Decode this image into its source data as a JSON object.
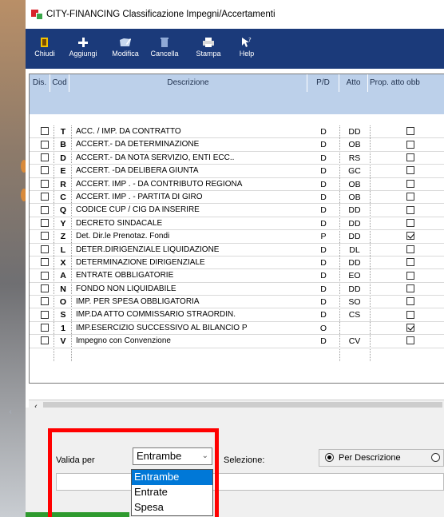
{
  "window": {
    "title": "CITY-FINANCING  Classificazione Impegni/Accertamenti"
  },
  "toolbar": {
    "chiudi": "Chiudi",
    "aggiungi": "Aggiungi",
    "modifica": "Modifica",
    "cancella": "Cancella",
    "stampa": "Stampa",
    "help": "Help"
  },
  "grid": {
    "headers": {
      "dis": "Dis.",
      "cod": "Cod",
      "descrizione": "Descrizione",
      "pd": "P/D",
      "atto": "Atto",
      "prop": "Prop. atto obb"
    },
    "rows": [
      {
        "cod": "T",
        "desc": "ACC. / IMP. DA CONTRATTO",
        "pd": "D",
        "atto": "DD",
        "prop": false
      },
      {
        "cod": "B",
        "desc": "ACCERT.- DA DETERMINAZIONE",
        "pd": "D",
        "atto": "OB",
        "prop": false
      },
      {
        "cod": "D",
        "desc": "ACCERT.- DA NOTA SERVIZIO, ENTI ECC..",
        "pd": "D",
        "atto": "RS",
        "prop": false
      },
      {
        "cod": "E",
        "desc": "ACCERT. -DA DELIBERA GIUNTA",
        "pd": "D",
        "atto": "GC",
        "prop": false
      },
      {
        "cod": "R",
        "desc": "ACCERT. IMP . - DA CONTRIBUTO REGIONA",
        "pd": "D",
        "atto": "OB",
        "prop": false
      },
      {
        "cod": "C",
        "desc": "ACCERT. IMP . -  PARTITA DI GIRO",
        "pd": "D",
        "atto": "OB",
        "prop": false
      },
      {
        "cod": "Q",
        "desc": "CODICE CUP / CIG DA INSERIRE",
        "pd": "D",
        "atto": "DD",
        "prop": false
      },
      {
        "cod": "Y",
        "desc": "DECRETO SINDACALE",
        "pd": "D",
        "atto": "DD",
        "prop": false
      },
      {
        "cod": "Z",
        "desc": "Det. Dir.le Prenotaz. Fondi",
        "pd": "P",
        "atto": "DD",
        "prop": true
      },
      {
        "cod": "L",
        "desc": "DETER.DIRIGENZIALE LIQUIDAZIONE",
        "pd": "D",
        "atto": "DL",
        "prop": false
      },
      {
        "cod": "X",
        "desc": "DETERMINAZIONE DIRIGENZIALE",
        "pd": "D",
        "atto": "DD",
        "prop": false
      },
      {
        "cod": "A",
        "desc": "ENTRATE OBBLIGATORIE",
        "pd": "D",
        "atto": "EO",
        "prop": false
      },
      {
        "cod": "N",
        "desc": "FONDO NON LIQUIDABILE",
        "pd": "D",
        "atto": "DD",
        "prop": false
      },
      {
        "cod": "O",
        "desc": "IMP. PER SPESA OBBLIGATORIA",
        "pd": "D",
        "atto": "SO",
        "prop": false
      },
      {
        "cod": "S",
        "desc": "IMP.DA ATTO COMMISSARIO STRAORDIN.",
        "pd": "D",
        "atto": "CS",
        "prop": false
      },
      {
        "cod": "1",
        "desc": "IMP.ESERCIZIO SUCCESSIVO AL BILANCIO P",
        "pd": "O",
        "atto": "",
        "prop": true
      },
      {
        "cod": "V",
        "desc": "Impegno con Convenzione",
        "pd": "D",
        "atto": "CV",
        "prop": false
      }
    ]
  },
  "filters": {
    "valida_per_label": "Valida per",
    "valida_per_value": "Entrambe",
    "valida_per_options": [
      "Entrambe",
      "Entrate",
      "Spesa"
    ],
    "selezione_label": "Selezione:",
    "radio_per_descrizione": "Per Descrizione"
  },
  "colors": {
    "toolbar_bg": "#1b3a7a",
    "header_bg": "#bcd0ea",
    "highlight": "#ff0000",
    "selected_option": "#0078d7"
  }
}
